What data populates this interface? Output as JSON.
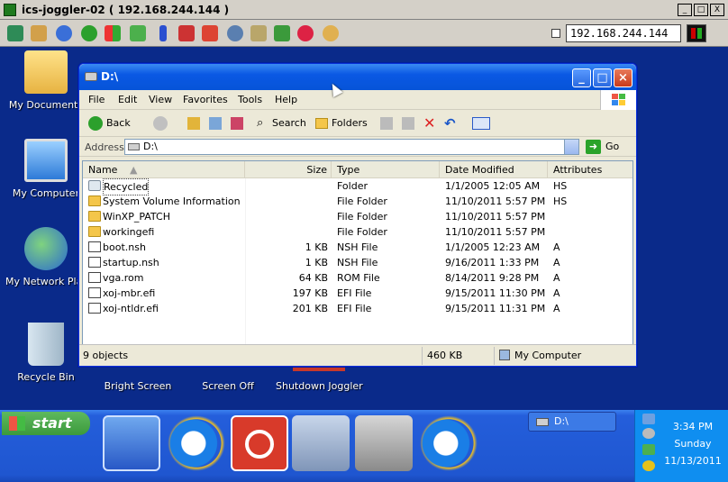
{
  "vnc": {
    "title": "ics-joggler-02 ( 192.168.244.144 )",
    "host": "192.168.244.144",
    "controls": [
      "_",
      "□",
      "X"
    ]
  },
  "desktop": {
    "icons": [
      {
        "label": "My Documents"
      },
      {
        "label": "My Computer"
      },
      {
        "label": "My Network Plac"
      },
      {
        "label": "Recycle Bin"
      },
      {
        "label": "Bright Screen"
      },
      {
        "label": "Screen Off"
      },
      {
        "label": "Shutdown Joggler"
      }
    ]
  },
  "explorer": {
    "title": "D:\\",
    "menu": [
      "File",
      "Edit",
      "View",
      "Favorites",
      "Tools",
      "Help"
    ],
    "toolbar": {
      "back": "Back",
      "search": "Search",
      "folders": "Folders"
    },
    "address": {
      "label": "Address",
      "value": "D:\\",
      "go": "Go"
    },
    "columns": [
      "Name",
      "Size",
      "Type",
      "Date Modified",
      "Attributes"
    ],
    "rows": [
      {
        "name": "Recycled",
        "size": "",
        "type": "Folder",
        "date": "1/1/2005 12:05 AM",
        "attr": "HS",
        "icon": "recycle"
      },
      {
        "name": "System Volume Information",
        "size": "",
        "type": "File Folder",
        "date": "11/10/2011 5:57 PM",
        "attr": "HS",
        "icon": "folder"
      },
      {
        "name": "WinXP_PATCH",
        "size": "",
        "type": "File Folder",
        "date": "11/10/2011 5:57 PM",
        "attr": "",
        "icon": "folder"
      },
      {
        "name": "workingefi",
        "size": "",
        "type": "File Folder",
        "date": "11/10/2011 5:57 PM",
        "attr": "",
        "icon": "folder"
      },
      {
        "name": "boot.nsh",
        "size": "1 KB",
        "type": "NSH File",
        "date": "1/1/2005 12:23 AM",
        "attr": "A",
        "icon": "file"
      },
      {
        "name": "startup.nsh",
        "size": "1 KB",
        "type": "NSH File",
        "date": "9/16/2011 1:33 PM",
        "attr": "A",
        "icon": "file"
      },
      {
        "name": "vga.rom",
        "size": "64 KB",
        "type": "ROM File",
        "date": "8/14/2011 9:28 PM",
        "attr": "A",
        "icon": "file"
      },
      {
        "name": "xoj-mbr.efi",
        "size": "197 KB",
        "type": "EFI File",
        "date": "9/15/2011 11:30 PM",
        "attr": "A",
        "icon": "file"
      },
      {
        "name": "xoj-ntldr.efi",
        "size": "201 KB",
        "type": "EFI File",
        "date": "9/15/2011 11:31 PM",
        "attr": "A",
        "icon": "file"
      }
    ],
    "status": {
      "objects": "9 objects",
      "size": "460 KB",
      "location": "My Computer"
    }
  },
  "taskbar": {
    "start": "start",
    "task": "D:\\",
    "clock": {
      "time": "3:34 PM",
      "day": "Sunday",
      "date": "11/13/2011"
    }
  }
}
